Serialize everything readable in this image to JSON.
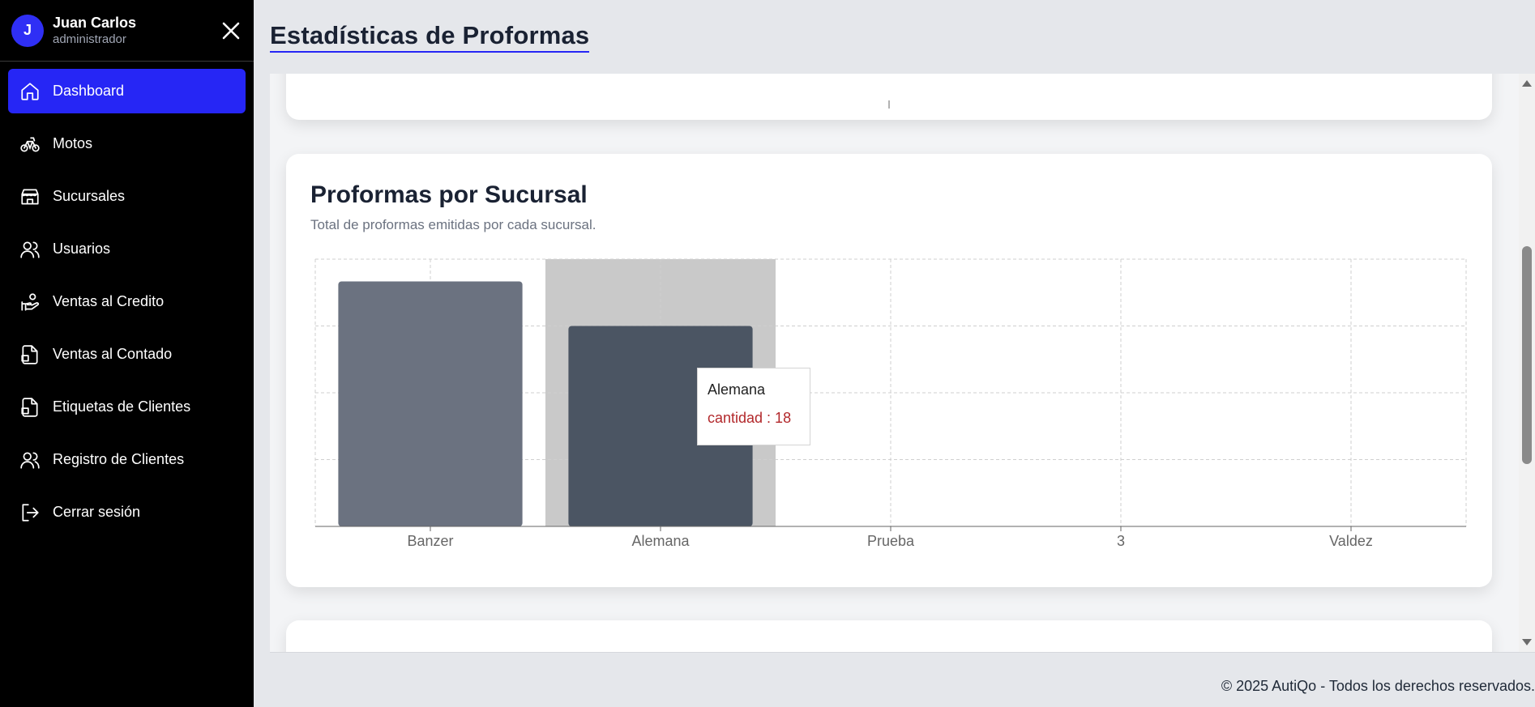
{
  "user": {
    "initial": "J",
    "name": "Juan Carlos",
    "role": "administrador"
  },
  "sidebar": {
    "items": [
      {
        "label": "Dashboard",
        "icon": "home-icon",
        "active": true
      },
      {
        "label": "Motos",
        "icon": "bicycle-icon"
      },
      {
        "label": "Sucursales",
        "icon": "store-icon"
      },
      {
        "label": "Usuarios",
        "icon": "users-icon"
      },
      {
        "label": "Ventas al Credito",
        "icon": "hand-coins-icon"
      },
      {
        "label": "Ventas al Contado",
        "icon": "file-cash-icon"
      },
      {
        "label": "Etiquetas de Clientes",
        "icon": "file-tag-icon"
      },
      {
        "label": "Registro de Clientes",
        "icon": "users-icon"
      },
      {
        "label": "Cerrar sesión",
        "icon": "logout-icon"
      }
    ]
  },
  "header": {
    "title": "Estadísticas de Proformas"
  },
  "card": {
    "title": "Proformas por Sucursal",
    "subtitle": "Total de proformas emitidas por cada sucursal."
  },
  "chart_data": {
    "type": "bar",
    "categories": [
      "Banzer",
      "Alemana",
      "Prueba",
      "3",
      "Valdez"
    ],
    "series": [
      {
        "name": "cantidad",
        "values": [
          22,
          18,
          0,
          0,
          0
        ]
      }
    ],
    "ylim": [
      0,
      24
    ],
    "grid": true,
    "highlighted_category": "Alemana",
    "colors": [
      "#6b7280",
      "#4b5563"
    ]
  },
  "tooltip": {
    "label": "Alemana",
    "value_text": "cantidad : 18"
  },
  "footer": {
    "text": "© 2025 AutiQo - Todos los derechos reservados."
  }
}
